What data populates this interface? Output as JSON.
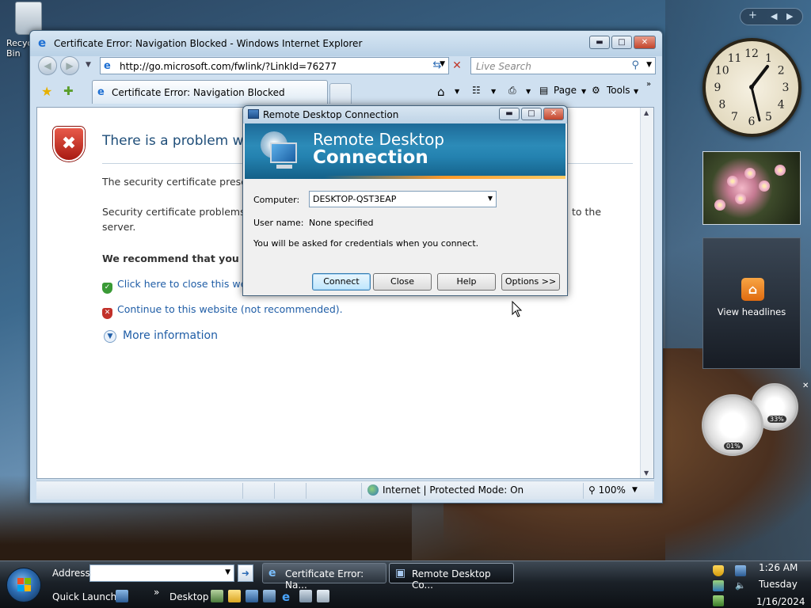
{
  "desktop": {
    "recycle_bin_label": "Recycle Bin"
  },
  "ie": {
    "title": "Certificate Error: Navigation Blocked - Windows Internet Explorer",
    "address": "http://go.microsoft.com/fwlink/?LinkId=76277",
    "search_placeholder": "Live Search",
    "tab_label": "Certificate Error: Navigation Blocked",
    "cmd_page": "Page",
    "cmd_tools": "Tools",
    "page": {
      "heading": "There is a problem with",
      "para1": "The security certificate presen",
      "para2_left": "Security certificate problems m",
      "para2_line2": "server.",
      "para2_right": "to the",
      "recommend": "We recommend that you cl",
      "opt_close": "Click here to close this we",
      "opt_continue": "Continue to this website (not recommended).",
      "more_info": "More information"
    },
    "status": {
      "zone": "Internet | Protected Mode: On",
      "zoom": "100%"
    }
  },
  "rdp": {
    "title": "Remote Desktop Connection",
    "banner_line1": "Remote Desktop",
    "banner_line2": "Connection",
    "computer_label": "Computer:",
    "computer_value": "DESKTOP-QST3EAP",
    "username_label": "User name:",
    "username_value": "None specified",
    "info": "You will be asked for credentials when you connect.",
    "buttons": {
      "connect": "Connect",
      "close": "Close",
      "help": "Help",
      "options": "Options >>"
    }
  },
  "sidebar": {
    "add_label": "+",
    "feed_label": "View headlines",
    "cpu_value": "01%",
    "mem_value": "33%",
    "clock_numbers": [
      "12",
      "1",
      "2",
      "3",
      "4",
      "5",
      "6",
      "7",
      "8",
      "9",
      "10",
      "11"
    ]
  },
  "taskbar": {
    "address_label": "Address",
    "quick_launch_label": "Quick Launch",
    "desktop_label": "Desktop",
    "tasks": [
      {
        "label": "Certificate Error: Na..."
      },
      {
        "label": "Remote Desktop Co..."
      }
    ],
    "time": "1:26 AM",
    "day": "Tuesday",
    "date": "1/16/2024"
  }
}
